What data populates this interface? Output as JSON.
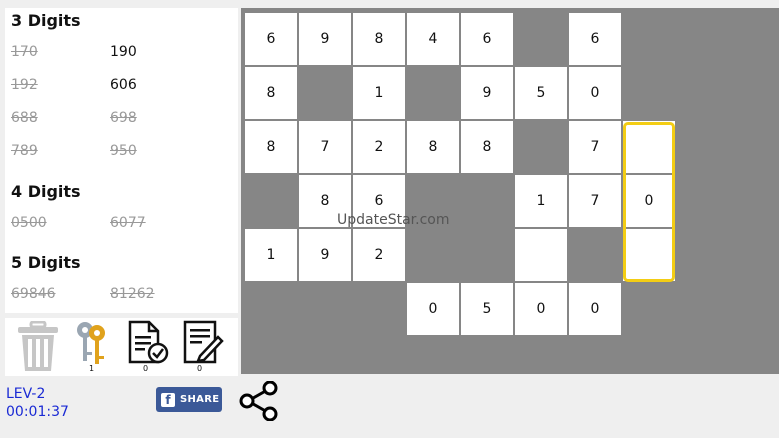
{
  "clues": {
    "sections": [
      {
        "title": "3 Digits",
        "items": [
          {
            "text": "170",
            "used": true
          },
          {
            "text": "190",
            "used": false
          },
          {
            "text": "192",
            "used": true
          },
          {
            "text": "606",
            "used": false
          },
          {
            "text": "688",
            "used": true
          },
          {
            "text": "698",
            "used": true
          },
          {
            "text": "789",
            "used": true
          },
          {
            "text": "950",
            "used": true
          }
        ]
      },
      {
        "title": "4 Digits",
        "items": [
          {
            "text": "0500",
            "used": true
          },
          {
            "text": "6077",
            "used": true
          }
        ]
      },
      {
        "title": "5 Digits",
        "items": [
          {
            "text": "69846",
            "used": true
          },
          {
            "text": "81262",
            "used": true
          }
        ]
      }
    ]
  },
  "toolbar": {
    "icons": [
      "trash-icon",
      "keys-icon",
      "document-check-icon",
      "document-edit-icon"
    ],
    "hint_count": "1",
    "check_count": "0",
    "edit_count": "0"
  },
  "board": {
    "rows": [
      [
        "6",
        "9",
        "8",
        "4",
        "6",
        null,
        "6"
      ],
      [
        "8",
        null,
        "1",
        null,
        "9",
        "5",
        "0"
      ],
      [
        "8",
        "7",
        "2",
        "8",
        "8",
        null,
        "7",
        ""
      ],
      [
        null,
        "8",
        "6",
        null,
        null,
        "1",
        "7",
        "0"
      ],
      [
        "1",
        "9",
        "2",
        null,
        null,
        "",
        null,
        ""
      ],
      [
        null,
        null,
        null,
        "0",
        "5",
        "0",
        "0"
      ]
    ],
    "selection_color": "#f3cd14"
  },
  "watermark": "UpdateStar.com",
  "status": {
    "level": "LEV-2",
    "timer": "00:01:37"
  },
  "social": {
    "facebook_label": "SHARE",
    "icons": [
      "facebook-icon",
      "share-icon"
    ]
  },
  "colors": {
    "board_bg": "#868686",
    "status_text": "#1a2ad4",
    "facebook": "#3b5998"
  }
}
